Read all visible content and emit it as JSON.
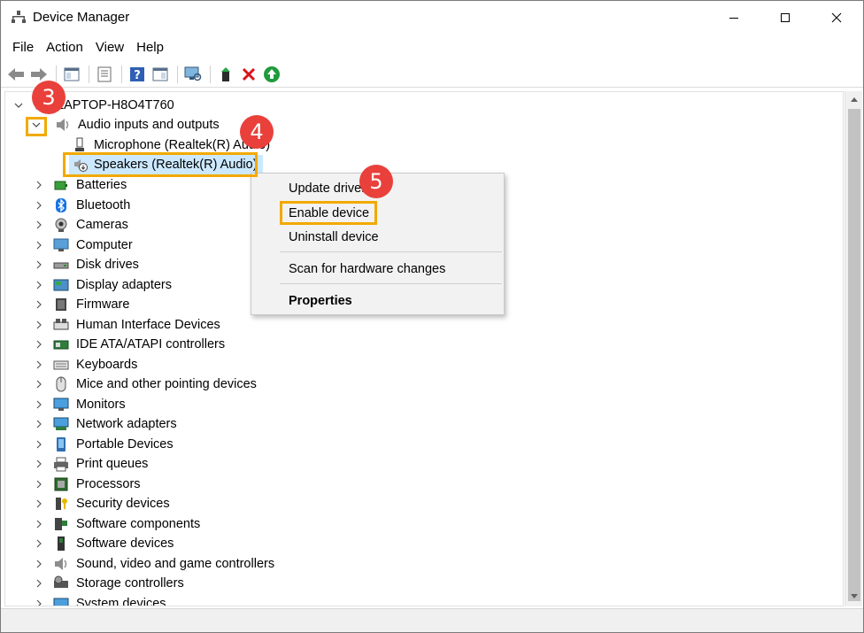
{
  "window": {
    "title": "Device Manager"
  },
  "menu": [
    "File",
    "Action",
    "View",
    "Help"
  ],
  "tree": {
    "root": "LAPTOP-H8O4T760",
    "expanded_category": "Audio inputs and outputs",
    "children": [
      "Microphone (Realtek(R) Audio)",
      "Speakers (Realtek(R) Audio)"
    ],
    "categories": [
      {
        "label": "Batteries",
        "icon": "battery-icon"
      },
      {
        "label": "Bluetooth",
        "icon": "bluetooth-icon"
      },
      {
        "label": "Cameras",
        "icon": "camera-icon"
      },
      {
        "label": "Computer",
        "icon": "computer-icon"
      },
      {
        "label": "Disk drives",
        "icon": "disk-drive-icon"
      },
      {
        "label": "Display adapters",
        "icon": "display-adapter-icon"
      },
      {
        "label": "Firmware",
        "icon": "firmware-icon"
      },
      {
        "label": "Human Interface Devices",
        "icon": "hid-icon"
      },
      {
        "label": "IDE ATA/ATAPI controllers",
        "icon": "ide-controller-icon"
      },
      {
        "label": "Keyboards",
        "icon": "keyboard-icon"
      },
      {
        "label": "Mice and other pointing devices",
        "icon": "mouse-icon"
      },
      {
        "label": "Monitors",
        "icon": "monitor-icon"
      },
      {
        "label": "Network adapters",
        "icon": "network-adapter-icon"
      },
      {
        "label": "Portable Devices",
        "icon": "portable-device-icon"
      },
      {
        "label": "Print queues",
        "icon": "printer-icon"
      },
      {
        "label": "Processors",
        "icon": "processor-icon"
      },
      {
        "label": "Security devices",
        "icon": "security-device-icon"
      },
      {
        "label": "Software components",
        "icon": "software-component-icon"
      },
      {
        "label": "Software devices",
        "icon": "software-device-icon"
      },
      {
        "label": "Sound, video and game controllers",
        "icon": "speaker-icon"
      },
      {
        "label": "Storage controllers",
        "icon": "storage-controller-icon"
      },
      {
        "label": "System devices",
        "icon": "system-device-icon"
      }
    ]
  },
  "context_menu": {
    "update": "Update driver",
    "enable": "Enable device",
    "uninstall": "Uninstall device",
    "scan": "Scan for hardware changes",
    "properties": "Properties"
  },
  "callouts": {
    "step3": "3",
    "step4": "4",
    "step5": "5"
  },
  "colors": {
    "highlight": "#f2a900",
    "badge": "#e9403b",
    "selection": "#cce8ff"
  }
}
